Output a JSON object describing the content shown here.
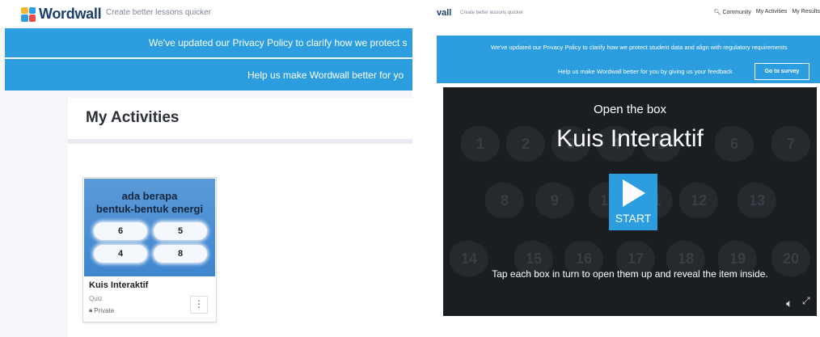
{
  "left": {
    "logo_text": "Wordwall",
    "tagline": "Create better lessons quicker",
    "banner_privacy": "We've updated our Privacy Policy to clarify how we protect s",
    "banner_feedback": "Help us make Wordwall better for yo",
    "page_title": "My Activities",
    "card": {
      "thumb_line1": "ada berapa",
      "thumb_line2": "bentuk-bentuk energi",
      "answers": [
        "6",
        "5",
        "4",
        "8"
      ],
      "name": "Kuis Interaktif",
      "type": "Quiz",
      "visibility": "Private"
    }
  },
  "right": {
    "logo_partial": "vall",
    "tagline": "Create better lessons quicker",
    "nav": [
      "Community",
      "My Activities",
      "My Results"
    ],
    "banner_privacy": "We've updated our Privacy Policy to clarify how we protect student data and align with regulatory requirements",
    "banner_feedback": "Help us make Wordwall better for you by giving us your feedback",
    "survey_button": "Go to survey",
    "game": {
      "template_name": "Open the box",
      "title": "Kuis Interaktif",
      "start_label": "START",
      "instructions": "Tap each box in turn to open them up and reveal the item inside.",
      "boxes": [
        "1",
        "2",
        "3",
        "4",
        "5",
        "6",
        "7",
        "8",
        "9",
        "10",
        "11",
        "12",
        "13",
        "14",
        "15",
        "16",
        "17",
        "18",
        "19",
        "20"
      ]
    }
  },
  "colors": {
    "banner_blue": "#2c9ee0",
    "game_bg": "#1b1e21"
  }
}
